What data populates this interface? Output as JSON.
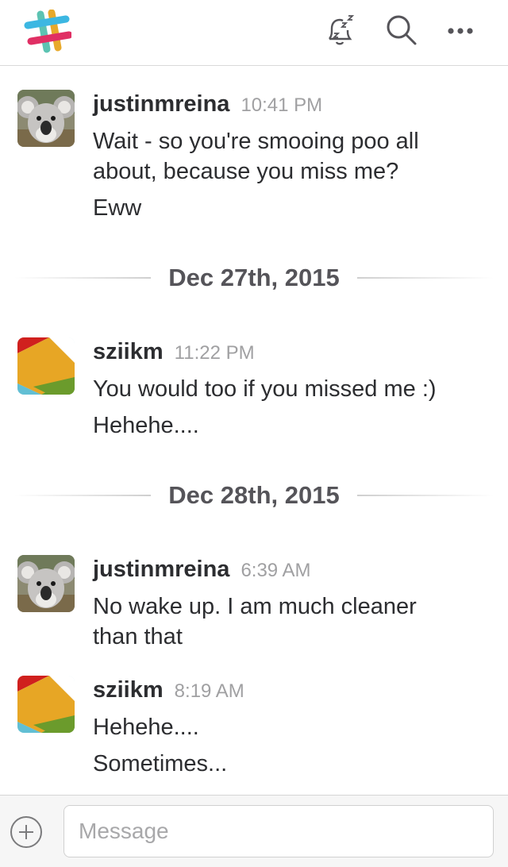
{
  "toolbar": {
    "logo_icon": "slack-logo-icon",
    "snooze_icon": "bell-snooze-icon",
    "search_icon": "search-icon",
    "more_icon": "more-horizontal-icon"
  },
  "messages": [
    {
      "author": "justinmreina",
      "time": "10:41 PM",
      "avatar": "koala-avatar",
      "lines": [
        "Wait - so you're smooing poo all",
        "about, because you miss me?",
        "Eww"
      ]
    },
    {
      "author": "sziikm",
      "time": "11:22 PM",
      "avatar": "colorful-tile-avatar",
      "lines": [
        "You would too if you missed me :)",
        "Hehehe...."
      ]
    },
    {
      "author": "justinmreina",
      "time": "6:39 AM",
      "avatar": "koala-avatar",
      "lines": [
        "No wake up. I am much cleaner",
        "than that"
      ]
    },
    {
      "author": "sziikm",
      "time": "8:19 AM",
      "avatar": "colorful-tile-avatar",
      "lines": [
        "Hehehe....",
        "Sometimes..."
      ]
    }
  ],
  "dividers": [
    "Dec 27th, 2015",
    "Dec 28th, 2015"
  ],
  "composer": {
    "placeholder": "Message",
    "value": "",
    "add_icon": "plus-circle-icon"
  }
}
